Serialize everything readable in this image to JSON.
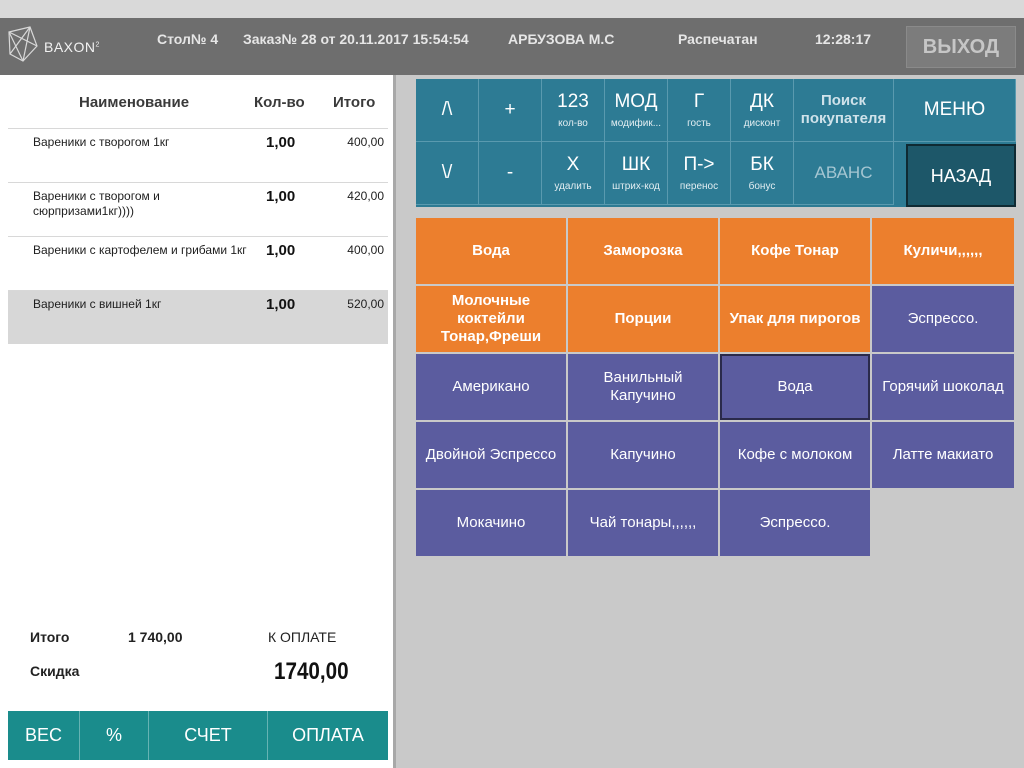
{
  "header": {
    "logo": "BAXON",
    "logo_sup": "2",
    "table": "Стол№ 4",
    "order": "Заказ№ 28 от 20.11.2017 15:54:54",
    "cashier": "АРБУЗОВА М.С",
    "status": "Распечатан",
    "time": "12:28:17",
    "exit_label": "ВЫХОД"
  },
  "order_table": {
    "columns": {
      "name": "Наименование",
      "qty": "Кол-во",
      "total": "Итого"
    },
    "rows": [
      {
        "name": "Вареники с творогом 1кг",
        "qty": "1,00",
        "total": "400,00"
      },
      {
        "name": "Вареники с творогом и сюрпризами1кг))))",
        "qty": "1,00",
        "total": "420,00"
      },
      {
        "name": "Вареники с картофелем и грибами 1кг",
        "qty": "1,00",
        "total": "400,00"
      },
      {
        "name": "Вареники с вишней 1кг",
        "qty": "1,00",
        "total": "520,00"
      }
    ],
    "selected_row": 3
  },
  "totals": {
    "total_label": "Итого",
    "total_value": "1 740,00",
    "due_label": "К ОПЛАТЕ",
    "discount_label": "Скидка",
    "due_value": "1740,00"
  },
  "bottom_buttons": [
    {
      "label": "ВЕС"
    },
    {
      "label": "%"
    },
    {
      "label": "СЧЕТ"
    },
    {
      "label": "ОПЛАТА"
    }
  ],
  "keypad": {
    "row1": [
      {
        "main": "/\\",
        "sub": ""
      },
      {
        "main": "+",
        "sub": ""
      },
      {
        "main": "123",
        "sub": "кол-во"
      },
      {
        "main": "МОД",
        "sub": "модифик..."
      },
      {
        "main": "Г",
        "sub": "гость"
      },
      {
        "main": "ДК",
        "sub": "дисконт"
      },
      {
        "main": "Поиск покупателя",
        "sub": ""
      },
      {
        "main": "МЕНЮ",
        "sub": ""
      }
    ],
    "row2": [
      {
        "main": "\\/",
        "sub": ""
      },
      {
        "main": "-",
        "sub": ""
      },
      {
        "main": "Х",
        "sub": "удалить"
      },
      {
        "main": "ШК",
        "sub": "штрих-код"
      },
      {
        "main": "П->",
        "sub": "перенос"
      },
      {
        "main": "БК",
        "sub": "бонус"
      },
      {
        "main": "АВАНС",
        "sub": ""
      },
      {
        "main": "НАЗАД",
        "sub": ""
      }
    ]
  },
  "products": {
    "categories": [
      "Вода",
      "Заморозка",
      "Кофе Тонар",
      "Куличи,,,,,,",
      "Молочные коктейли Тонар,Фреши",
      "Порции",
      "Упак для пирогов"
    ],
    "items": [
      "Эспрессо.",
      "Американо",
      "Ванильный Капучино",
      "Вода",
      "Горячий  шоколад",
      "Двойной Эспрессо",
      "Капучино",
      "Кофе с молоком",
      "Латте макиато",
      "Мокачино",
      "Чай тонары,,,,,,",
      "Эспрессо."
    ]
  },
  "colors": {
    "header_bg": "#6e6e6e",
    "keypad_bg": "#2d7b94",
    "category_bg": "#ec7f2d",
    "item_bg": "#5b5c9f",
    "bottombar_bg": "#1a8c8c"
  }
}
